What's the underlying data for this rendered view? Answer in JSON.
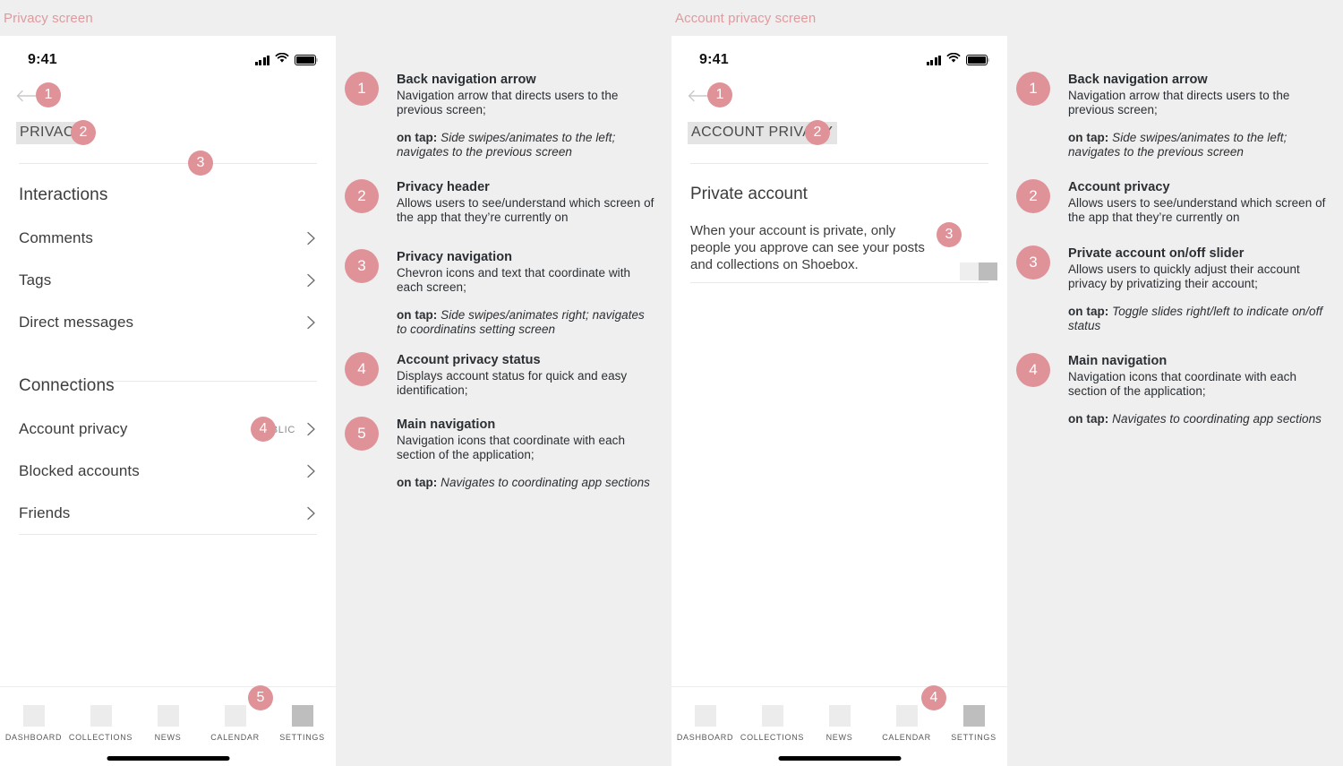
{
  "sections": {
    "left_title": "Privacy screen",
    "right_title": "Account privacy screen"
  },
  "colors": {
    "accent": "#df9399",
    "section_title": "#e09a9e",
    "page_background": "#efefef",
    "phone_background": "#ffffff",
    "header_chip_background": "#e4e4e4",
    "toggle_track": "#eeeeee",
    "toggle_knob": "#bcbcbc",
    "tab_icon": "#ececec",
    "tab_icon_active": "#bebebe"
  },
  "phone_left": {
    "status": {
      "time": "9:41",
      "signal_icon": "cellular-signal-icon",
      "wifi_icon": "wifi-icon",
      "battery_icon": "battery-icon"
    },
    "back_icon": "back-arrow-icon",
    "header": "PRIVACY",
    "markers": [
      "1",
      "2",
      "3",
      "4",
      "5"
    ],
    "groups": [
      {
        "heading": "Interactions",
        "rows": [
          {
            "label": "Comments",
            "value": "",
            "chevron": "chevron-right-icon"
          },
          {
            "label": "Tags",
            "value": "",
            "chevron": "chevron-right-icon"
          },
          {
            "label": "Direct messages",
            "value": "",
            "chevron": "chevron-right-icon"
          }
        ]
      },
      {
        "heading": "Connections",
        "rows": [
          {
            "label": "Account privacy",
            "value": "PUBLIC",
            "chevron": "chevron-right-icon"
          },
          {
            "label": "Blocked accounts",
            "value": "",
            "chevron": "chevron-right-icon"
          },
          {
            "label": "Friends",
            "value": "",
            "chevron": "chevron-right-icon"
          }
        ]
      }
    ],
    "tabs": [
      {
        "label": "DASHBOARD",
        "icon": "dashboard-icon",
        "active": false
      },
      {
        "label": "COLLECTIONS",
        "icon": "collections-icon",
        "active": false
      },
      {
        "label": "NEWS",
        "icon": "news-icon",
        "active": false
      },
      {
        "label": "CALENDAR",
        "icon": "calendar-icon",
        "active": false
      },
      {
        "label": "SETTINGS",
        "icon": "settings-icon",
        "active": true
      }
    ]
  },
  "phone_right": {
    "status": {
      "time": "9:41",
      "signal_icon": "cellular-signal-icon",
      "wifi_icon": "wifi-icon",
      "battery_icon": "battery-icon"
    },
    "back_icon": "back-arrow-icon",
    "header": "ACCOUNT PRIVACY",
    "markers": [
      "1",
      "2",
      "3",
      "4"
    ],
    "section_title": "Private account",
    "section_body": "When your account is private, only people you approve can see your posts and collections on Shoebox.",
    "toggle": {
      "name": "private-account-toggle",
      "state": "on"
    },
    "tabs": [
      {
        "label": "DASHBOARD",
        "icon": "dashboard-icon",
        "active": false
      },
      {
        "label": "COLLECTIONS",
        "icon": "collections-icon",
        "active": false
      },
      {
        "label": "NEWS",
        "icon": "news-icon",
        "active": false
      },
      {
        "label": "CALENDAR",
        "icon": "calendar-icon",
        "active": false
      },
      {
        "label": "SETTINGS",
        "icon": "settings-icon",
        "active": true
      }
    ]
  },
  "annotations_left": [
    {
      "number": "1",
      "title": "Back navigation arrow",
      "desc": "Navigation arrow that directs users to the previous screen;",
      "ontap_label": "on tap:",
      "ontap": " Side swipes/animates to the left; navigates to the previous screen"
    },
    {
      "number": "2",
      "title": "Privacy header",
      "desc": "Allows users to see/understand which screen of the app that they’re currently on",
      "ontap_label": "",
      "ontap": ""
    },
    {
      "number": "3",
      "title": "Privacy navigation",
      "desc": "Chevron icons and text that coordinate with each screen;",
      "ontap_label": "on tap:",
      "ontap": " Side swipes/animates right; navigates to coordinatins setting screen"
    },
    {
      "number": "4",
      "title": "Account privacy status",
      "desc": "Displays account status for quick and easy identification;",
      "ontap_label": "",
      "ontap": ""
    },
    {
      "number": "5",
      "title": "Main navigation",
      "desc": "Navigation icons that coordinate with each section of the application;",
      "ontap_label": "on tap:",
      "ontap": " Navigates to coordinating app sections"
    }
  ],
  "annotations_right": [
    {
      "number": "1",
      "title": "Back navigation arrow",
      "desc": "Navigation arrow that directs users to the previous screen;",
      "ontap_label": "on tap:",
      "ontap": " Side swipes/animates to the left; navigates to the previous screen"
    },
    {
      "number": "2",
      "title": "Account privacy",
      "desc": "Allows users to see/understand which screen of the app that they’re currently on",
      "ontap_label": "",
      "ontap": ""
    },
    {
      "number": "3",
      "title": "Private account on/off slider",
      "desc": "Allows users to quickly adjust their account privacy by privatizing their account;",
      "ontap_label": "on tap:",
      "ontap": " Toggle slides right/left to indicate on/off status"
    },
    {
      "number": "4",
      "title": "Main navigation",
      "desc": "Navigation icons that coordinate with each section of the application;",
      "ontap_label": "on tap:",
      "ontap": " Navigates to coordinating app sections"
    }
  ]
}
